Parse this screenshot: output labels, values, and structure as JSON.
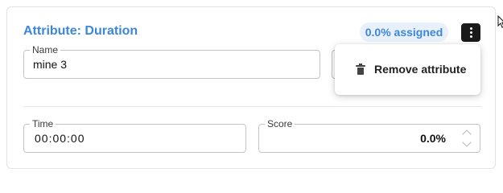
{
  "card": {
    "title": "Attribute: Duration",
    "assigned_badge": "0.0% assigned",
    "menu_icon": "more-vertical-icon"
  },
  "fields": {
    "name": {
      "label": "Name",
      "value": "mine 3"
    },
    "time": {
      "label": "Time",
      "value": "00:00:00"
    },
    "score": {
      "label": "Score",
      "value": "0.0%"
    }
  },
  "menu": {
    "items": [
      {
        "label": "Remove attribute",
        "icon": "trash-icon"
      }
    ]
  },
  "colors": {
    "accent": "#3d86d8",
    "badge_bg": "#e8f1fb",
    "kebab_bg": "#1a1a1a"
  }
}
